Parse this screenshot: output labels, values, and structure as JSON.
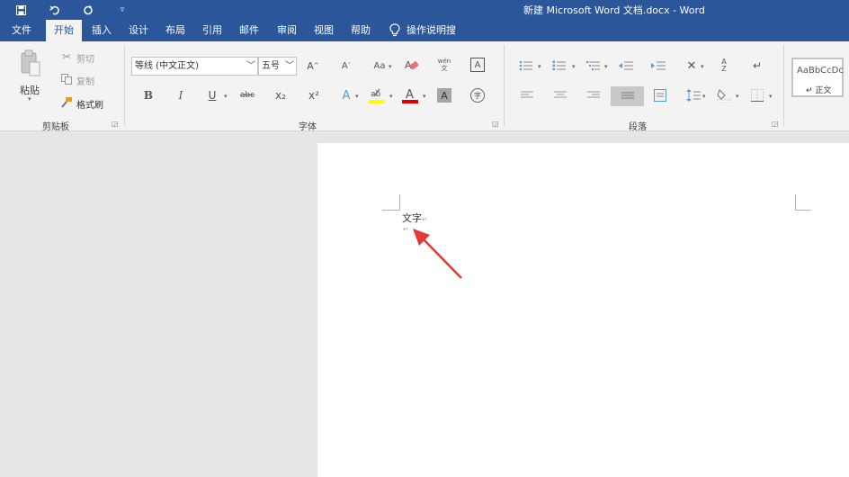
{
  "titlebar": {
    "title": "新建 Microsoft Word 文档.docx  -  Word",
    "quick_access": [
      "save-icon",
      "undo-icon",
      "redo-icon",
      "customize-qat-icon"
    ]
  },
  "tabs": [
    {
      "label": "文件",
      "active": false
    },
    {
      "label": "开始",
      "active": true
    },
    {
      "label": "插入",
      "active": false
    },
    {
      "label": "设计",
      "active": false
    },
    {
      "label": "布局",
      "active": false
    },
    {
      "label": "引用",
      "active": false
    },
    {
      "label": "邮件",
      "active": false
    },
    {
      "label": "审阅",
      "active": false
    },
    {
      "label": "视图",
      "active": false
    },
    {
      "label": "帮助",
      "active": false
    }
  ],
  "tell_me": {
    "label": "操作说明搜索",
    "icon": "lightbulb-icon"
  },
  "clipboard": {
    "paste_label": "粘贴",
    "cut_label": "剪切",
    "copy_label": "复制",
    "format_painter_label": "格式刷",
    "group_label": "剪贴板"
  },
  "font": {
    "font_name": "等线 (中文正文)",
    "font_size": "五号",
    "bold": "B",
    "italic": "I",
    "underline": "U",
    "strikethrough": "abc",
    "subscript": "x₂",
    "superscript": "x²",
    "change_case": "Aa",
    "phonetic": "wén 文",
    "group_label": "字体"
  },
  "paragraph": {
    "group_label": "段落"
  },
  "styles": {
    "preview_text": "AaBbCcDc",
    "normal_label": "↵ 正文"
  },
  "document": {
    "text": "文字",
    "para_mark": "↵"
  },
  "colors": {
    "accent": "#2b579a",
    "highlight": "#ffff00",
    "font_color": "#e00000",
    "annotation_arrow": "#e53935"
  }
}
